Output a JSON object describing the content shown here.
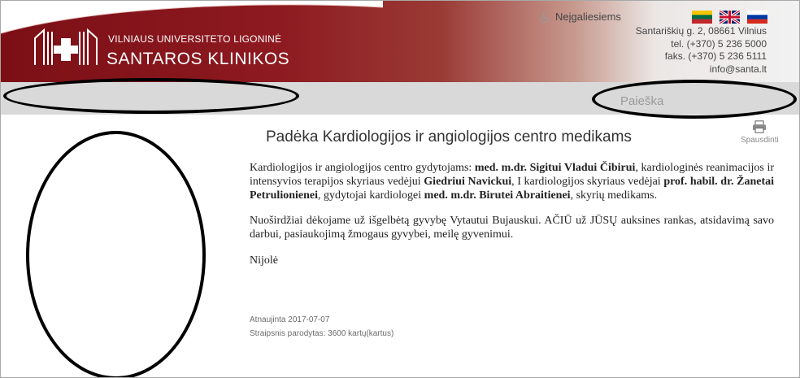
{
  "brand": {
    "line1": "VILNIAUS UNIVERSITETO LIGONINĖ",
    "line2": "SANTAROS KLINIKOS",
    "accent_color": "#8d1a20"
  },
  "accessibility": {
    "label": "Neįgaliesiems",
    "icon": "wheelchair-icon"
  },
  "languages": [
    {
      "code": "lt",
      "icon": "flag-lithuania-icon"
    },
    {
      "code": "en",
      "icon": "flag-uk-icon"
    },
    {
      "code": "ru",
      "icon": "flag-russia-icon"
    }
  ],
  "contact": {
    "address": "Santariškių g. 2, 08661 Vilnius",
    "phone": "tel. (+370) 5 236 5000",
    "fax": "faks. (+370) 5 236 5111",
    "email": "info@santa.lt"
  },
  "search": {
    "label": "Paieška"
  },
  "article": {
    "title": "Padėka Kardiologijos ir angiologijos centro medikams",
    "print_label": "Spausdinti",
    "p1": {
      "t1": "Kardiologijos ir angiologijos centro gydytojams: ",
      "b1": "med. m.dr. Sigitui Vladui Čibirui",
      "t2": ", kardiologinės reanimacijos ir intensyvios terapijos skyriaus vedėjui ",
      "b2": "Giedriui Navickui",
      "t3": ", I kardiologijos skyriaus vedėjai ",
      "b3": "prof. habil. dr. Žanetai Petrulionienei",
      "t4": ", gydytojai kardiologei ",
      "b4": "med. m.dr. Birutei Abraitienei",
      "t5": ", skyrių medikams."
    },
    "p2": "Nuoširdžiai dėkojame už išgelbėtą gyvybę Vytautui Bujauskui. AČIŪ už JŪSŲ auksines rankas, atsidavimą savo darbui, pasiaukojimą žmogaus gyvybei, meilę gyvenimui.",
    "p3": "Nijolė",
    "updated": "Atnaujinta 2017-07-07",
    "views": "Straipsnis parodytas: 3600 kartų(kartus)"
  }
}
